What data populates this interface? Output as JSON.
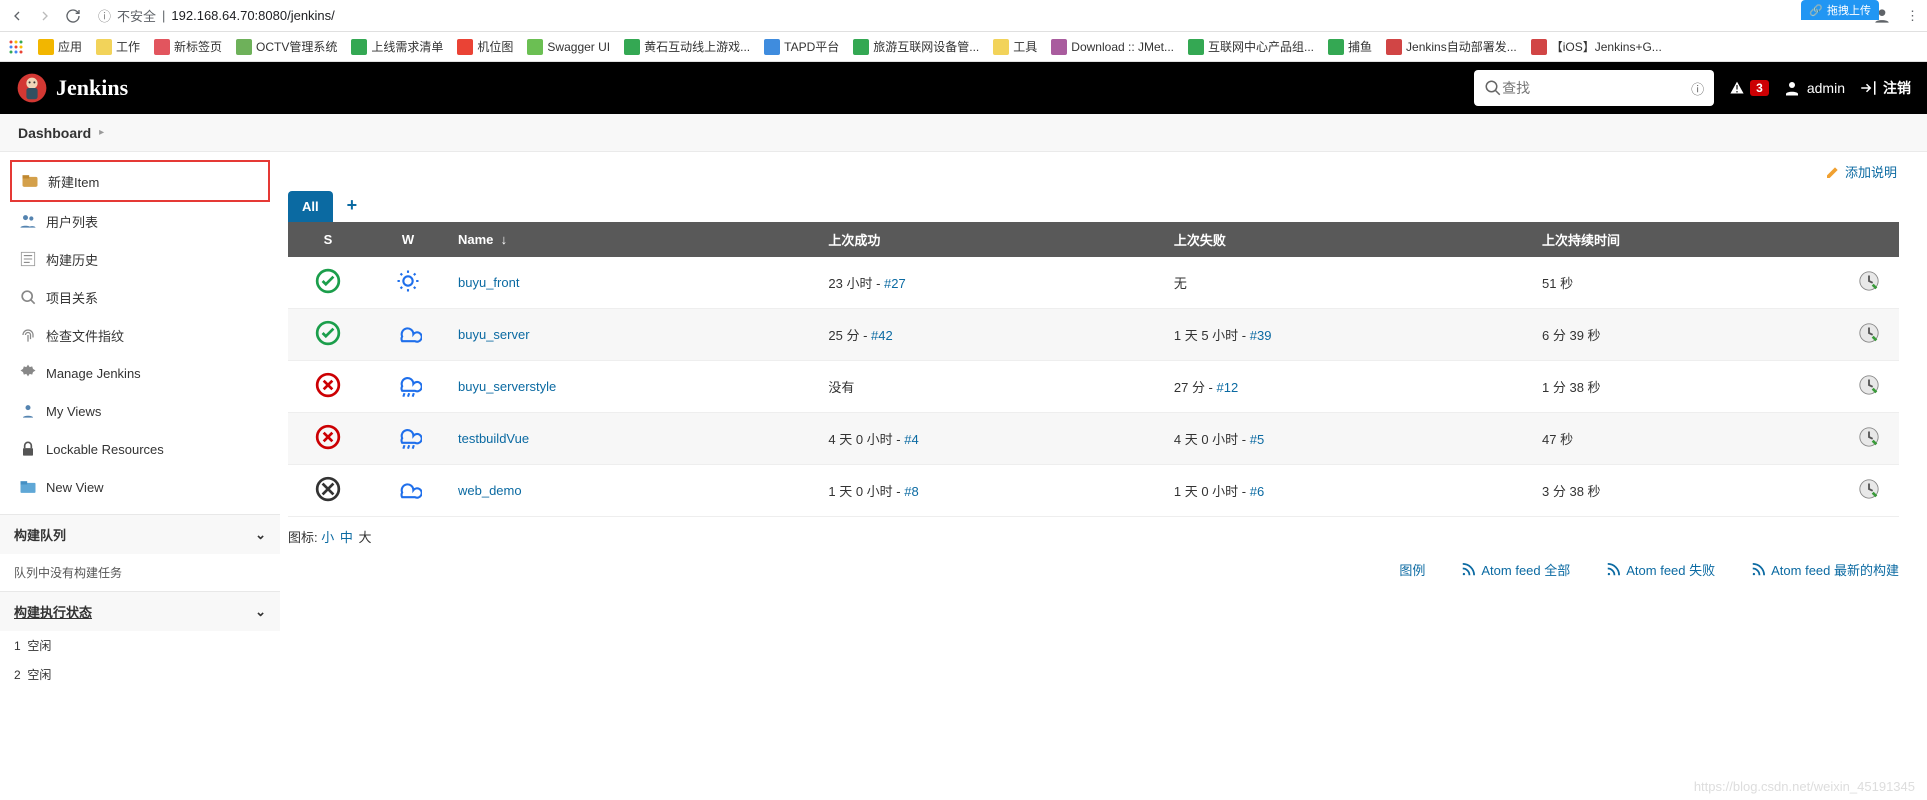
{
  "browser": {
    "insecure_label": "不安全",
    "url": "192.168.64.70:8080/jenkins/",
    "ext_label": "拖拽上传"
  },
  "bookmarks": [
    {
      "label": "应用",
      "color": "#f2b600"
    },
    {
      "label": "工作",
      "color": "#f2d35a"
    },
    {
      "label": "新标签页",
      "color": "#e2555e"
    },
    {
      "label": "OCTV管理系统",
      "color": "#6eb15a"
    },
    {
      "label": "上线需求清单",
      "color": "#34a853"
    },
    {
      "label": "机位图",
      "color": "#ea4335"
    },
    {
      "label": "Swagger UI",
      "color": "#6bbf53"
    },
    {
      "label": "黄石互动线上游戏...",
      "color": "#34a853"
    },
    {
      "label": "TAPD平台",
      "color": "#3f8cde"
    },
    {
      "label": "旅游互联网设备管...",
      "color": "#34a853"
    },
    {
      "label": "工具",
      "color": "#f2d35a"
    },
    {
      "label": "Download :: JMet...",
      "color": "#a95c9e"
    },
    {
      "label": "互联网中心产品组...",
      "color": "#34a853"
    },
    {
      "label": "捕鱼",
      "color": "#34a853"
    },
    {
      "label": "Jenkins自动部署发...",
      "color": "#d14545"
    },
    {
      "label": "【iOS】Jenkins+G...",
      "color": "#d14545"
    }
  ],
  "header": {
    "title": "Jenkins",
    "search_placeholder": "查找",
    "alert_count": "3",
    "user": "admin",
    "logout": "注销"
  },
  "breadcrumb": {
    "dashboard": "Dashboard"
  },
  "sidebar": {
    "tasks": [
      {
        "label": "新建Item",
        "icon": "new-item"
      },
      {
        "label": "用户列表",
        "icon": "people"
      },
      {
        "label": "构建历史",
        "icon": "history"
      },
      {
        "label": "项目关系",
        "icon": "relation"
      },
      {
        "label": "检查文件指纹",
        "icon": "fingerprint"
      },
      {
        "label": "Manage Jenkins",
        "icon": "gear"
      },
      {
        "label": "My Views",
        "icon": "views"
      },
      {
        "label": "Lockable Resources",
        "icon": "lock"
      },
      {
        "label": "New View",
        "icon": "new-view"
      }
    ],
    "queue_title": "构建队列",
    "queue_empty": "队列中没有构建任务",
    "exec_title": "构建执行状态",
    "exec_idle": "空闲",
    "exec1": "1",
    "exec2": "2"
  },
  "content": {
    "add_description": "添加说明",
    "tab_all": "All",
    "columns": {
      "s": "S",
      "w": "W",
      "name": "Name",
      "name_arrow": "↓",
      "last_success": "上次成功",
      "last_failure": "上次失败",
      "last_duration": "上次持续时间"
    },
    "jobs": [
      {
        "status": "success",
        "weather": "sunny",
        "name": "buyu_front",
        "last_success_time": "23 小时",
        "last_success_build": "#27",
        "last_failure_text": "无",
        "last_failure_build": "",
        "duration": "51 秒"
      },
      {
        "status": "success",
        "weather": "cloudy",
        "name": "buyu_server",
        "last_success_time": "25 分",
        "last_success_build": "#42",
        "last_failure_text": "1 天 5 小时",
        "last_failure_build": "#39",
        "duration": "6 分 39 秒"
      },
      {
        "status": "failed",
        "weather": "rain",
        "name": "buyu_serverstyle",
        "last_success_time": "没有",
        "last_success_build": "",
        "last_failure_text": "27 分",
        "last_failure_build": "#12",
        "duration": "1 分 38 秒"
      },
      {
        "status": "failed",
        "weather": "rain",
        "name": "testbuildVue",
        "last_success_time": "4 天 0 小时",
        "last_success_build": "#4",
        "last_failure_text": "4 天 0 小时",
        "last_failure_build": "#5",
        "duration": "47 秒"
      },
      {
        "status": "disabled",
        "weather": "cloudy",
        "name": "web_demo",
        "last_success_time": "1 天 0 小时",
        "last_success_build": "#8",
        "last_failure_text": "1 天 0 小时",
        "last_failure_build": "#6",
        "duration": "3 分 38 秒"
      }
    ],
    "icon_size_label": "图标:",
    "icon_size_s": "小",
    "icon_size_m": "中",
    "icon_size_l": "大",
    "legend": "图例",
    "feed_all": "Atom feed 全部",
    "feed_fail": "Atom feed 失败",
    "feed_latest": "Atom feed 最新的构建"
  },
  "watermark": "https://blog.csdn.net/weixin_45191345"
}
